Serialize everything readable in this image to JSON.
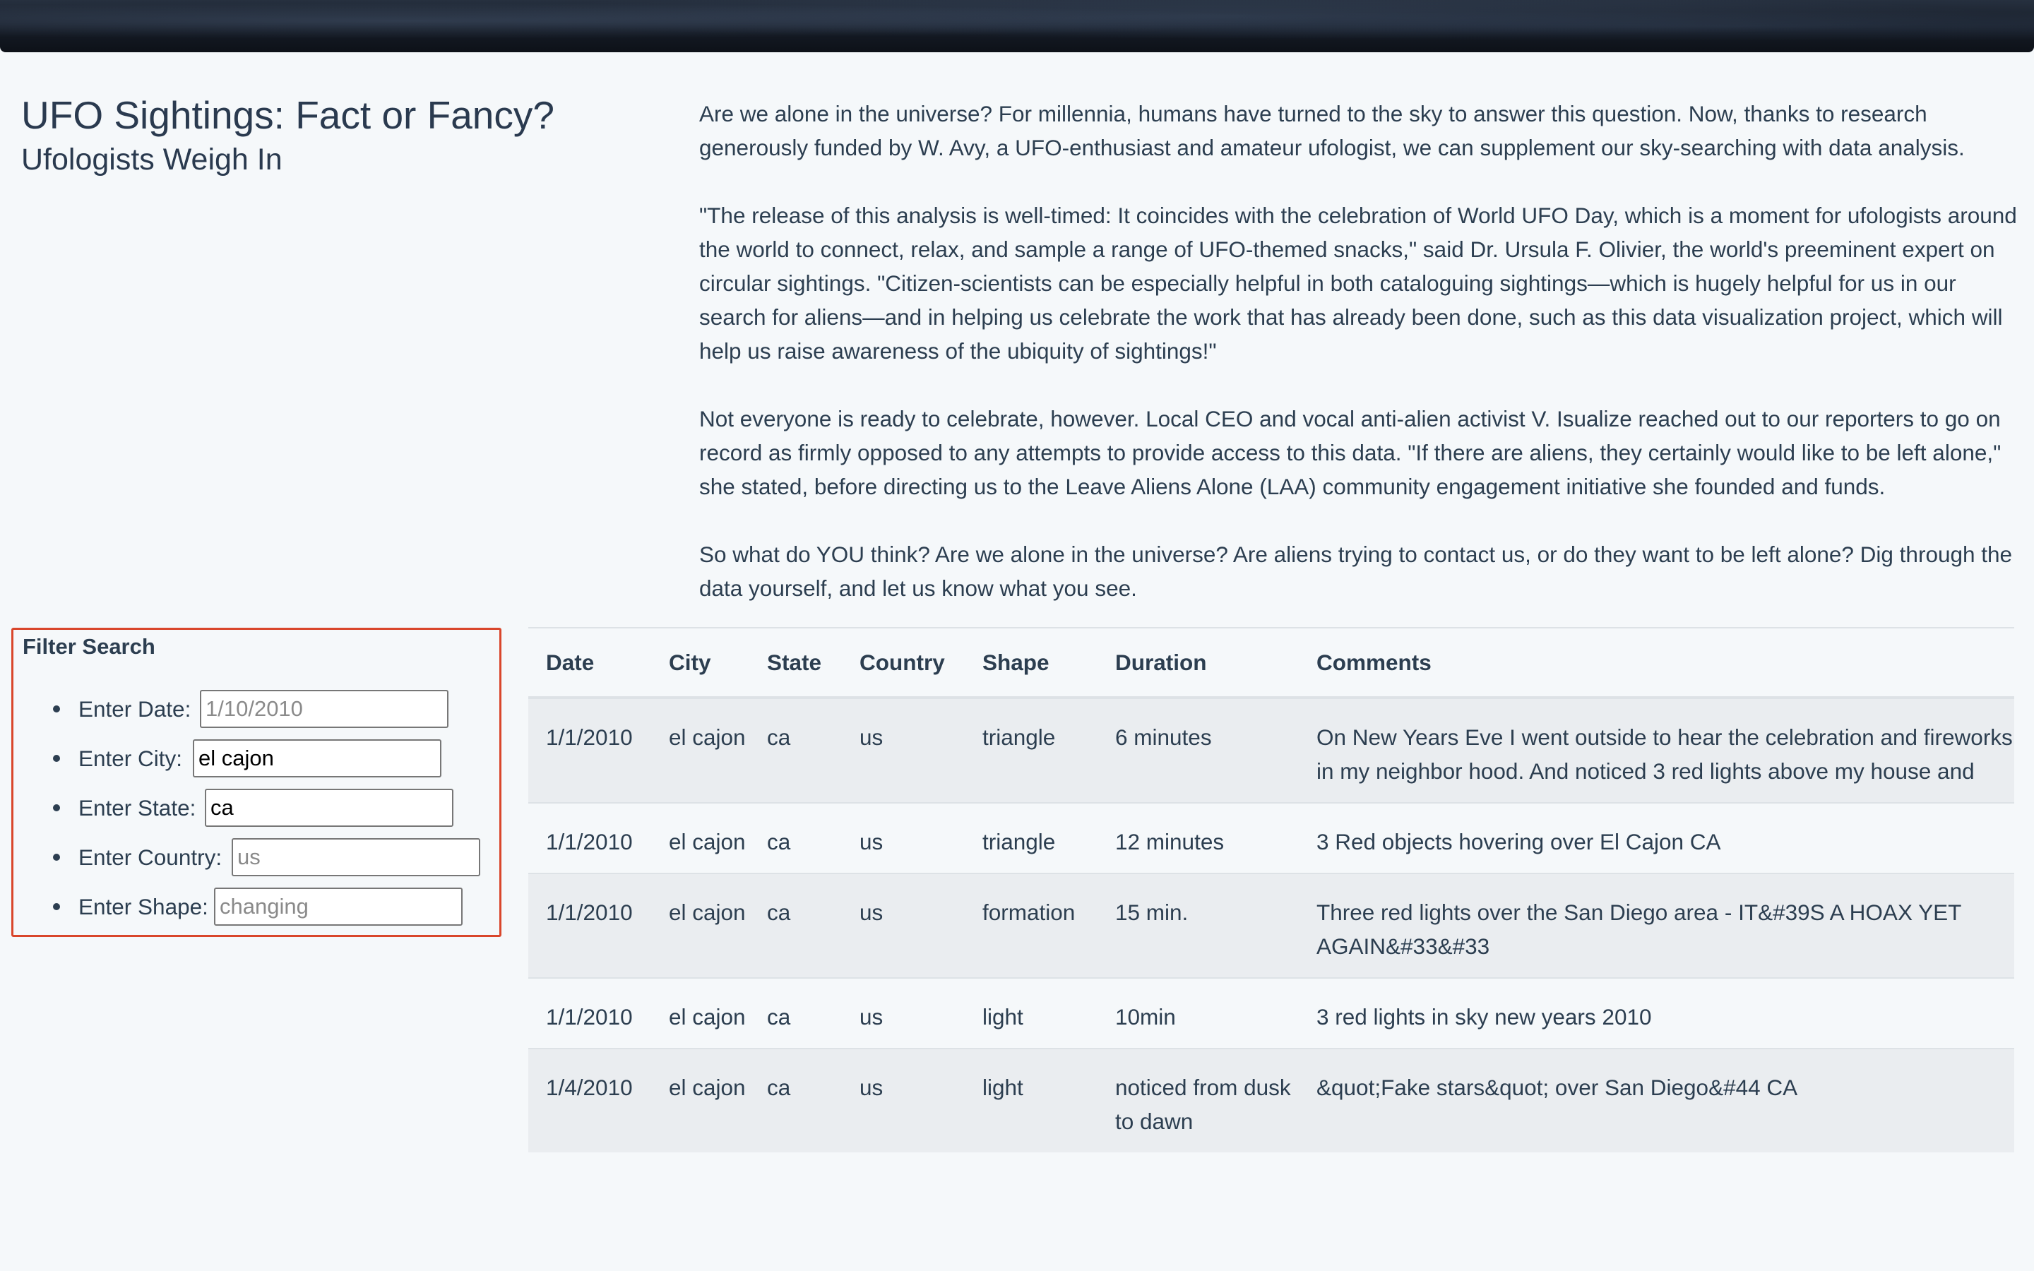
{
  "header": {
    "title": "UFO Sightings: Fact or Fancy?",
    "subtitle": "Ufologists Weigh In"
  },
  "article": {
    "paragraphs": [
      "Are we alone in the universe? For millennia, humans have turned to the sky to answer this question. Now, thanks to research generously funded by W. Avy, a UFO-enthusiast and amateur ufologist, we can supplement our sky-searching with data analysis.",
      "\"The release of this analysis is well-timed: It coincides with the celebration of World UFO Day, which is a moment for ufologists around the world to connect, relax, and sample a range of UFO-themed snacks,\" said Dr. Ursula F. Olivier, the world's preeminent expert on circular sightings. \"Citizen-scientists can be especially helpful in both cataloguing sightings—which is hugely helpful for us in our search for aliens—and in helping us celebrate the work that has already been done, such as this data visualization project, which will help us raise awareness of the ubiquity of sightings!\"",
      "Not everyone is ready to celebrate, however. Local CEO and vocal anti-alien activist V. Isualize reached out to our reporters to go on record as firmly opposed to any attempts to provide access to this data. \"If there are aliens, they certainly would like to be left alone,\" she stated, before directing us to the Leave Aliens Alone (LAA) community engagement initiative she founded and funds.",
      "So what do YOU think? Are we alone in the universe? Are aliens trying to contact us, or do they want to be left alone? Dig through the data yourself, and let us know what you see."
    ]
  },
  "filter": {
    "title": "Filter Search",
    "fields": [
      {
        "label": "Enter Date:",
        "value": "",
        "placeholder": "1/10/2010"
      },
      {
        "label": "Enter City:",
        "value": "el cajon",
        "placeholder": ""
      },
      {
        "label": "Enter State:",
        "value": "ca",
        "placeholder": ""
      },
      {
        "label": "Enter Country:",
        "value": "",
        "placeholder": "us"
      },
      {
        "label": "Enter Shape:",
        "value": "",
        "placeholder": "changing"
      }
    ]
  },
  "table": {
    "columns": [
      "Date",
      "City",
      "State",
      "Country",
      "Shape",
      "Duration",
      "Comments"
    ],
    "rows": [
      [
        "1/1/2010",
        "el cajon",
        "ca",
        "us",
        "triangle",
        "6 minutes",
        "On New Years Eve I went outside to hear the celebration and fireworks in my neighbor hood. And noticed 3 red lights above my house and"
      ],
      [
        "1/1/2010",
        "el cajon",
        "ca",
        "us",
        "triangle",
        "12 minutes",
        "3 Red objects hovering over El Cajon CA"
      ],
      [
        "1/1/2010",
        "el cajon",
        "ca",
        "us",
        "formation",
        "15 min.",
        "Three red lights over the San Diego area - IT&#39S A HOAX YET AGAIN&#33&#33"
      ],
      [
        "1/1/2010",
        "el cajon",
        "ca",
        "us",
        "light",
        "10min",
        "3 red lights in sky new years 2010"
      ],
      [
        "1/4/2010",
        "el cajon",
        "ca",
        "us",
        "light",
        "noticed from dusk to dawn",
        "&quot;Fake stars&quot; over San Diego&#44 CA"
      ]
    ]
  }
}
